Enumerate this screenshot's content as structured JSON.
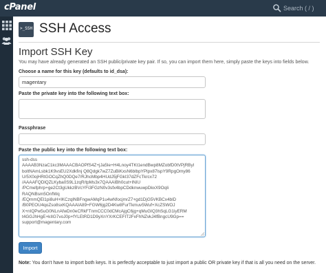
{
  "topbar": {
    "logo": "cPanel",
    "search_placeholder": "Search ( / )"
  },
  "sidebar": {
    "items": [
      {
        "icon": "grid-icon",
        "label": "Home"
      },
      {
        "icon": "users-icon",
        "label": "User Manager"
      }
    ]
  },
  "page": {
    "icon_text": ">_SSH",
    "title": "SSH Access"
  },
  "import": {
    "heading": "Import SSH Key",
    "intro": "You may have already generated an SSH public/private key pair. If so, you can import them here, simply paste the keys into fields below.",
    "name_label": "Choose a name for this key (defaults to id_dsa):",
    "name_value": "magentary",
    "private_label": "Paste the private key into the following text box:",
    "private_value": "",
    "passphrase_label": "Passphrase",
    "passphrase_value": "",
    "public_label": "Paste the public key into the following text box:",
    "public_lines": [
      "ssh-dss",
      "AAAAB3NzaC1kc3MAAACBAOPfS4Z+jJa5Ie+H4Lnoy4TKt1endBwp8MZobfD0tVPjRByl",
      "boltNAmLsbk1K9vsEU2Xdkfinj Q8Qdgk7wZ7ZuBiKxsN6blbpYPlpx87lspY9RpgOmy86",
      "U/5X0ojHRtGOCqZhQ0DQe7/RJhcMbp4HUdJ5jFGkI37dZFcTkrcx72",
      "/AAAAFQDlQZLKyba0S9L1zqR/tpMs3x7QAAAIBh0cut+lNIU",
      "/PCmefphrp+ge2Ct3gUkkzBVcYFi3FGzN0v3sfx4bpCDdknwuwpDkxX9OqIi",
      "RAQNBsm5OnfWq",
      "/EQmmQEl1pi8uH+lKCzqlNBFngwAMqP1u4wNfocjmrZ7+gd1DjG5VKBCx4blD",
      "/B0PEOU4qoZso8sxKQAAAIA89+FGW6jg2D4Kw8FurTkmuv5Wuf+XcZSWOJ",
      "X+nIQPw5uG0NLnAfwDn0eCRkFTnmCCC0dCMcAjgC6jg+qMuGIQ3hSqLG1iyERM",
      "t4GGJhHgE+kIIG7voJ0p+fYLEtRD1D9yXnYXrKCEFIT2FxFhNZvkJ4fBngcU9Gp==",
      "support@magentary.com"
    ],
    "import_button": "Import",
    "note_label": "Note:",
    "note_text": " You don't have to import both keys. It is perfectly acceptable to just import a public OR private key if that is all you need on the server."
  },
  "colors": {
    "topbar": "#293a4a",
    "sidebar": "#1f2d3a",
    "accent": "#3e83c4"
  }
}
